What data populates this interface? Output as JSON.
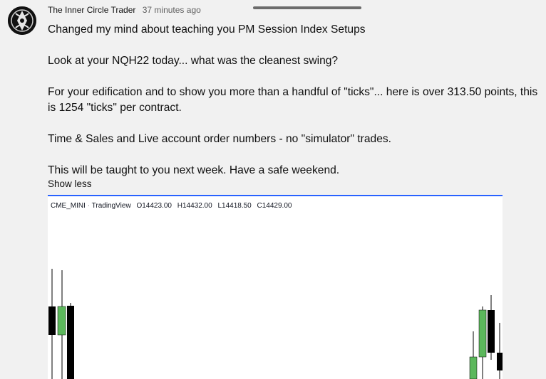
{
  "comment": {
    "author": "The Inner Circle Trader",
    "time": "37 minutes ago",
    "lines": [
      "Changed my mind about teaching you PM Session Index Setups",
      "",
      "Look at your NQH22 today... what was the cleanest swing?",
      "",
      "For your edification and to show you more than a handful of \"ticks\"... here is over 313.50 points, this is 1254 \"ticks\" per contract.",
      "",
      "Time & Sales and Live account order numbers - no \"simulator\" trades.",
      "",
      "This will be taught to you next week.  Have a safe weekend."
    ],
    "show_less_label": "Show less"
  },
  "chart": {
    "symbol": "CME_MINI",
    "separator": "·",
    "platform": "TradingView",
    "open": "O14423.00",
    "high": "H14432.00",
    "low": "L14418.50",
    "close": "C14429.00",
    "accent_color": "#2962ff",
    "up_color": "#5cb85c",
    "down_color": "#000000"
  },
  "icons": {
    "avatar": "channel-avatar-icon"
  }
}
